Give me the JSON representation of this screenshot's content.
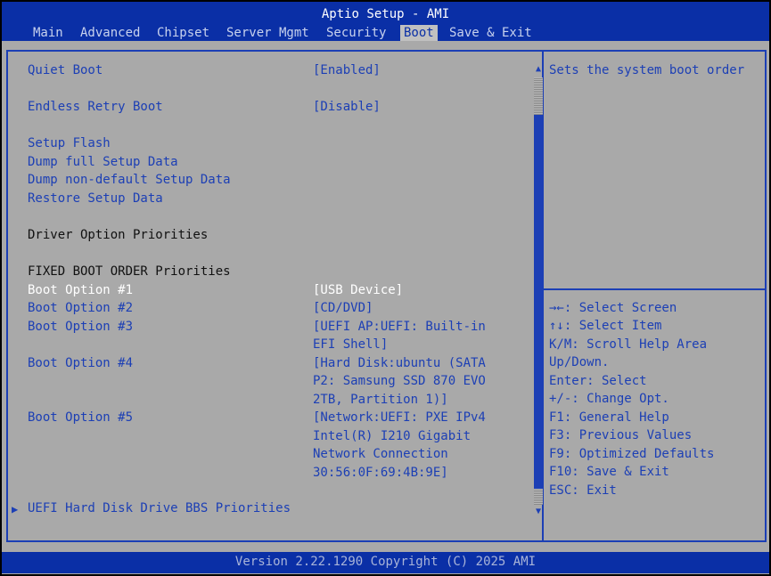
{
  "window": {
    "title": "Aptio Setup - AMI"
  },
  "menu": [
    {
      "label": "Main"
    },
    {
      "label": "Advanced"
    },
    {
      "label": "Chipset"
    },
    {
      "label": "Server Mgmt"
    },
    {
      "label": "Security"
    },
    {
      "label": "Boot",
      "active": true
    },
    {
      "label": "Save & Exit"
    }
  ],
  "settings": {
    "quiet_boot": {
      "label": "Quiet Boot",
      "value": "[Enabled]"
    },
    "endless_retry": {
      "label": "Endless Retry Boot",
      "value": "[Disable]"
    },
    "setup_flash": "Setup Flash",
    "dump_full": "Dump full Setup Data",
    "dump_nondefault": "Dump non-default Setup Data",
    "restore_setup": "Restore Setup Data",
    "driver_priorities": "Driver Option Priorities",
    "fixed_boot_order": "FIXED BOOT ORDER Priorities",
    "boot_options": [
      {
        "label": "Boot Option #1",
        "value_lines": [
          "[USB Device]"
        ],
        "selected": true
      },
      {
        "label": "Boot Option #2",
        "value_lines": [
          "[CD/DVD]"
        ]
      },
      {
        "label": "Boot Option #3",
        "value_lines": [
          "[UEFI AP:UEFI: Built-in",
          "EFI Shell]"
        ]
      },
      {
        "label": "Boot Option #4",
        "value_lines": [
          "[Hard Disk:ubuntu (SATA",
          "P2: Samsung SSD 870 EVO",
          "2TB, Partition 1)]"
        ]
      },
      {
        "label": "Boot Option #5",
        "value_lines": [
          "[Network:UEFI: PXE IPv4",
          "Intel(R) I210 Gigabit",
          "Network Connection",
          "30:56:0F:69:4B:9E]"
        ]
      }
    ],
    "uefi_hdd_bbs": "UEFI Hard Disk Drive BBS Priorities"
  },
  "help": {
    "text": "Sets the system boot order",
    "keys": [
      "→←: Select Screen",
      "↑↓: Select Item",
      "K/M: Scroll Help Area",
      "Up/Down.",
      "Enter: Select",
      "+/-: Change Opt.",
      "F1: General Help",
      "F3: Previous Values",
      "F9: Optimized Defaults",
      "F10: Save & Exit",
      "ESC: Exit"
    ]
  },
  "scrollbar": {
    "up_icon": "scroll-up-arrow",
    "down_icon": "scroll-down-arrow"
  },
  "footer": {
    "version": "Version 2.22.1290 Copyright (C) 2025 AMI"
  },
  "colors": {
    "header_bg": "#0a2fa6",
    "panel_bg": "#a9a9a9",
    "option_text": "#1c3fb5",
    "selected_text": "#ffffff"
  }
}
